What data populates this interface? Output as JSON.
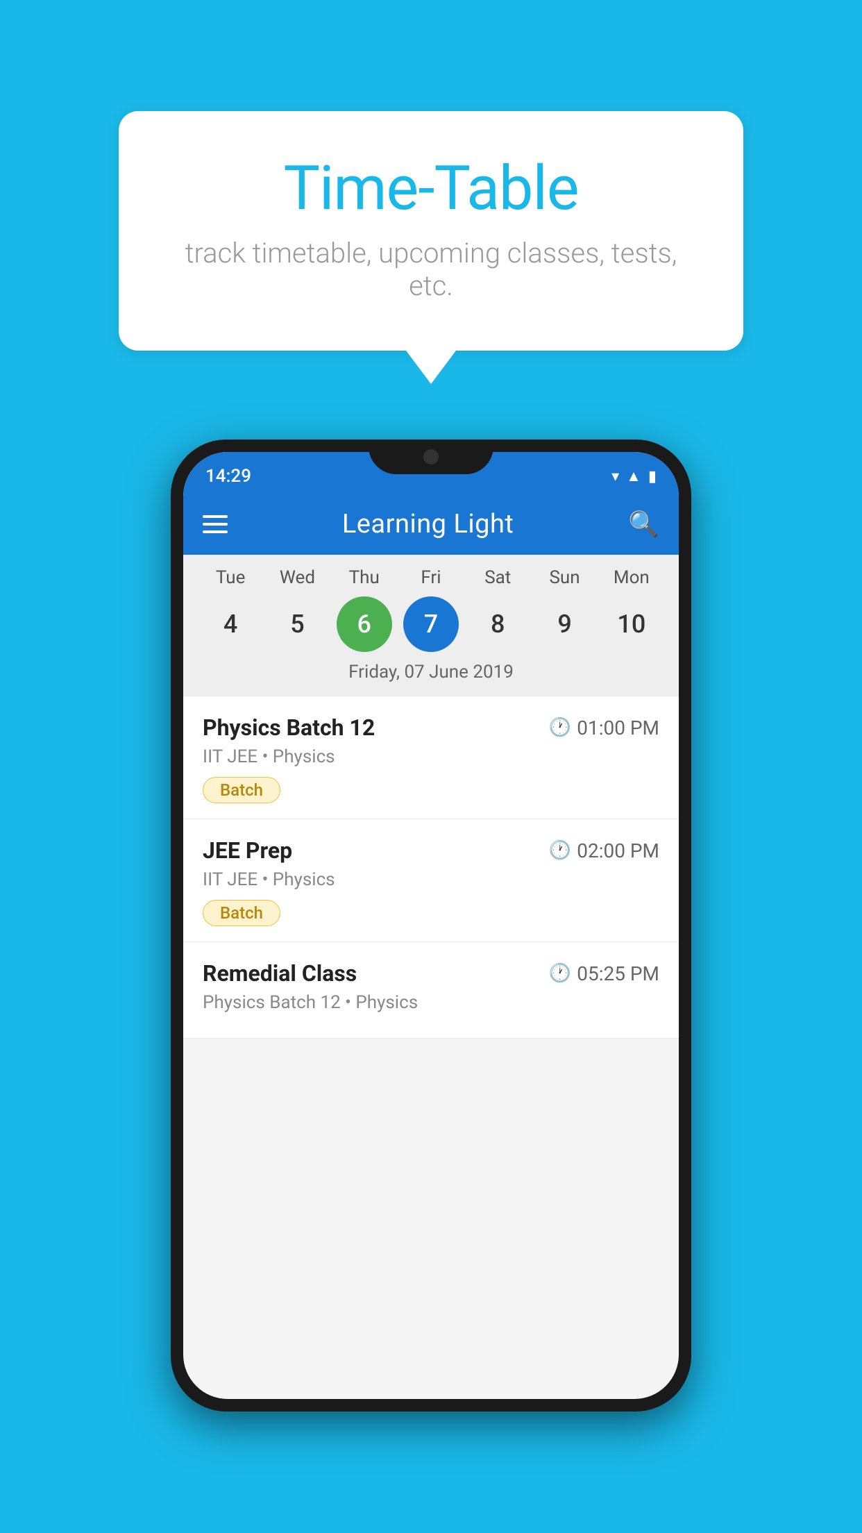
{
  "background_color": "#1ab8e8",
  "speech_bubble": {
    "title": "Time-Table",
    "subtitle": "track timetable, upcoming classes, tests, etc."
  },
  "phone": {
    "status_bar": {
      "time": "14:29"
    },
    "app_bar": {
      "title": "Learning Light"
    },
    "calendar": {
      "days": [
        "Tue",
        "Wed",
        "Thu",
        "Fri",
        "Sat",
        "Sun",
        "Mon"
      ],
      "dates": [
        4,
        5,
        6,
        7,
        8,
        9,
        10
      ],
      "today_index": 2,
      "selected_index": 3,
      "selected_label": "Friday, 07 June 2019"
    },
    "schedule": [
      {
        "title": "Physics Batch 12",
        "time": "01:00 PM",
        "sub": "IIT JEE • Physics",
        "badge": "Batch"
      },
      {
        "title": "JEE Prep",
        "time": "02:00 PM",
        "sub": "IIT JEE • Physics",
        "badge": "Batch"
      },
      {
        "title": "Remedial Class",
        "time": "05:25 PM",
        "sub": "Physics Batch 12 • Physics",
        "badge": null
      }
    ]
  }
}
